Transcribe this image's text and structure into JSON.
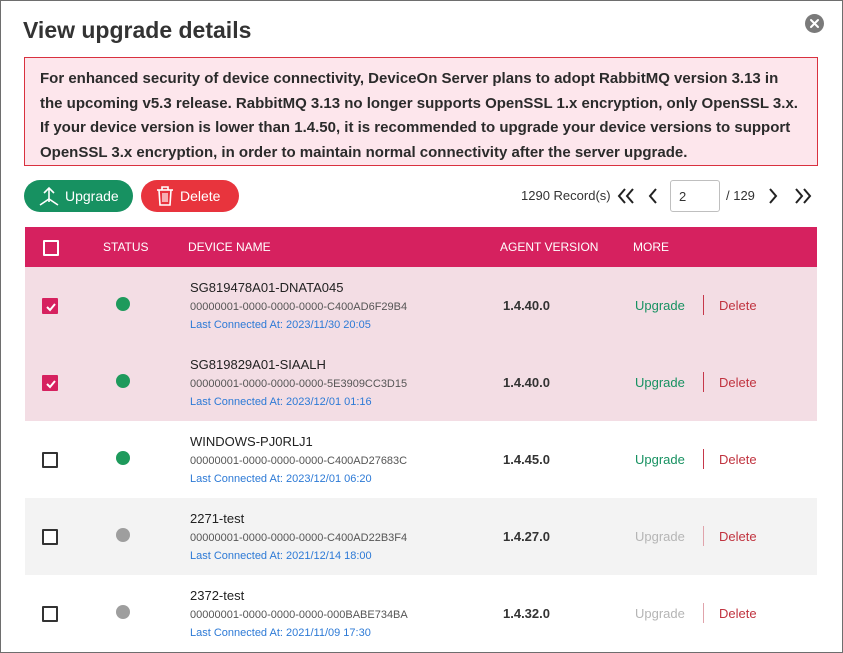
{
  "dialog": {
    "title": "View upgrade details",
    "close_icon": "close-icon"
  },
  "alert": {
    "message": "For enhanced security of device connectivity, DeviceOn Server plans to adopt RabbitMQ version 3.13 in the upcoming v5.3 release. RabbitMQ 3.13 no longer supports OpenSSL 1.x encryption, only OpenSSL 3.x. If your device version is lower than 1.4.50, it is recommended to upgrade your device versions to support OpenSSL 3.x encryption, in order to maintain normal connectivity after the server upgrade.",
    "border_color": "#d9313f",
    "background": "#fde6ec"
  },
  "toolbar": {
    "upgrade_label": "Upgrade",
    "upgrade_icon": "upload-antenna-icon",
    "delete_label": "Delete",
    "delete_icon": "trash-icon",
    "upgrade_color": "#179161",
    "delete_color": "#e8343d"
  },
  "pager": {
    "records": "1290 Record(s)",
    "current_page": "2",
    "total_pages": "/ 129",
    "icons": [
      "double-chevron-left-icon",
      "chevron-left-icon",
      "chevron-right-icon",
      "double-chevron-right-icon"
    ]
  },
  "table": {
    "header_color": "#d6215f",
    "columns": {
      "status": "STATUS",
      "device_name": "DEVICE NAME",
      "agent_version": "AGENT VERSION",
      "more": "MORE"
    },
    "rows": [
      {
        "name": "SG819478A01-DNATA045",
        "id": "00000001-0000-0000-0000-C400AD6F29B4",
        "connected": "Last Connected At: 2023/11/30 20:05",
        "agent": "1.4.40.0",
        "status": "online",
        "checked": true,
        "upgrade": "Upgrade",
        "delete": "Delete",
        "upgrade_enabled": true
      },
      {
        "name": "SG819829A01-SIAALH",
        "id": "00000001-0000-0000-0000-5E3909CC3D15",
        "connected": "Last Connected At: 2023/12/01 01:16",
        "agent": "1.4.40.0",
        "status": "online",
        "checked": true,
        "upgrade": "Upgrade",
        "delete": "Delete",
        "upgrade_enabled": true
      },
      {
        "name": "WINDOWS-PJ0RLJ1",
        "id": "00000001-0000-0000-0000-C400AD27683C",
        "connected": "Last Connected At: 2023/12/01 06:20",
        "agent": "1.4.45.0",
        "status": "online",
        "checked": false,
        "upgrade": "Upgrade",
        "delete": "Delete",
        "upgrade_enabled": true
      },
      {
        "name": "2271-test",
        "id": "00000001-0000-0000-0000-C400AD22B3F4",
        "connected": "Last Connected At: 2021/12/14 18:00",
        "agent": "1.4.27.0",
        "status": "offline",
        "checked": false,
        "upgrade": "Upgrade",
        "delete": "Delete",
        "upgrade_enabled": false
      },
      {
        "name": "2372-test",
        "id": "00000001-0000-0000-0000-000BABE734BA",
        "connected": "Last Connected At: 2021/11/09 17:30",
        "agent": "1.4.32.0",
        "status": "offline",
        "checked": false,
        "upgrade": "Upgrade",
        "delete": "Delete",
        "upgrade_enabled": false
      }
    ],
    "status_colors": {
      "online": "#1e9a5c",
      "offline": "#9e9e9e"
    }
  }
}
